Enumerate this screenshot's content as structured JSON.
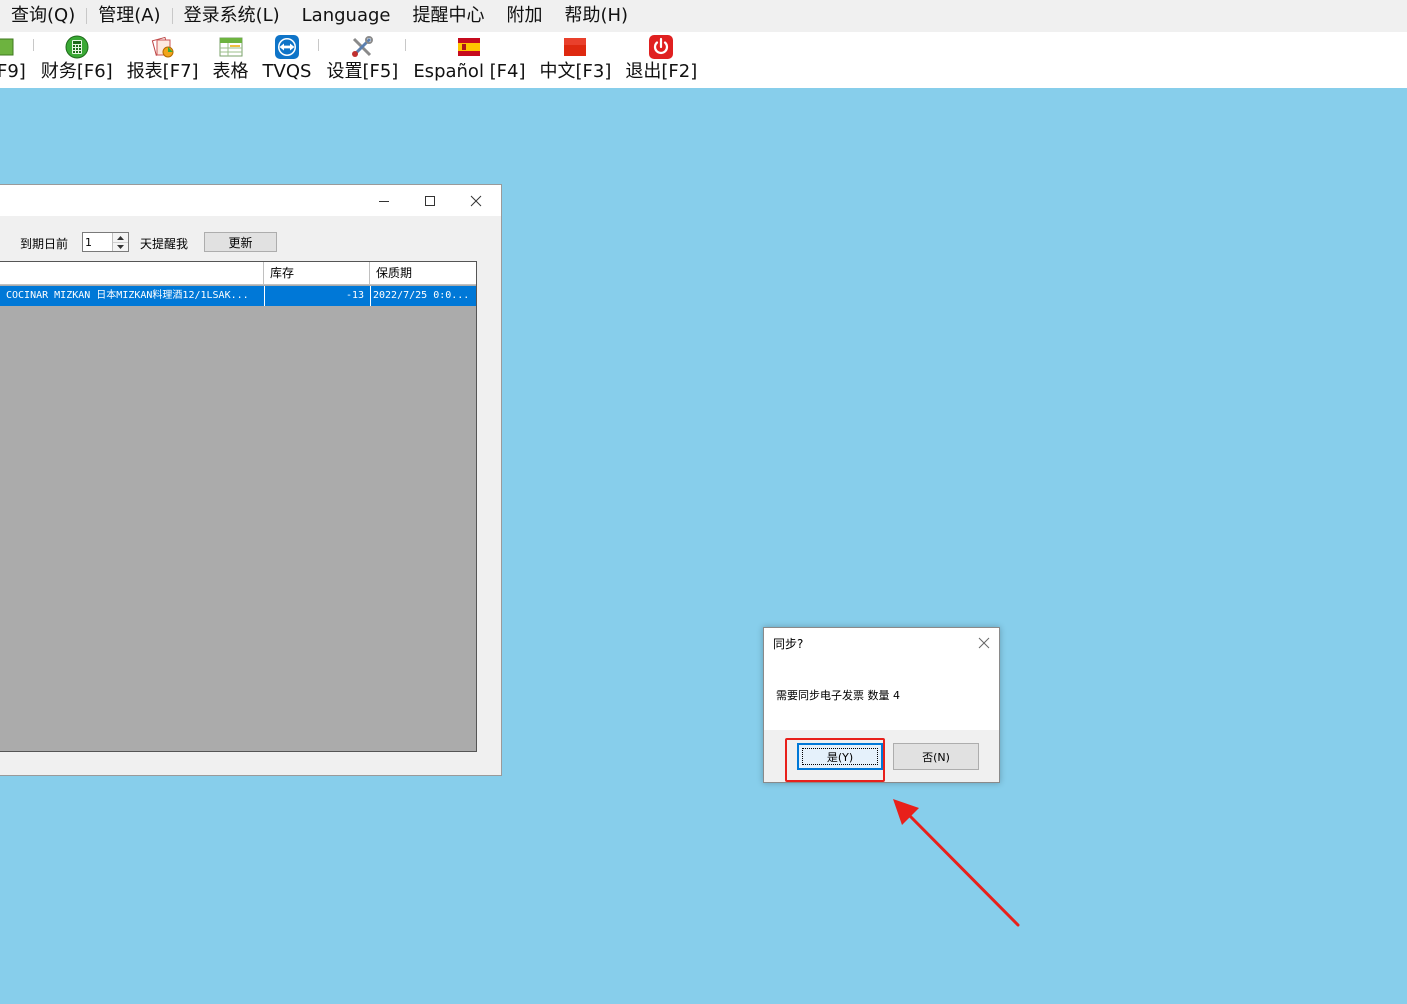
{
  "menubar": {
    "items": [
      "查询(Q)",
      "管理(A)",
      "登录系统(L)",
      "Language",
      "提醒中心",
      "附加",
      "帮助(H)"
    ]
  },
  "toolbar": {
    "items": [
      {
        "label": "F9]",
        "icon": "partial-icon"
      },
      {
        "label": "财务[F6]",
        "icon": "calculator-icon"
      },
      {
        "label": "报表[F7]",
        "icon": "report-icon"
      },
      {
        "label": "表格",
        "icon": "spreadsheet-icon"
      },
      {
        "label": "TVQS",
        "icon": "teamviewer-icon"
      },
      {
        "label": "设置[F5]",
        "icon": "tools-icon"
      },
      {
        "label": "Español [F4]",
        "icon": "spain-flag-icon"
      },
      {
        "label": "中文[F3]",
        "icon": "china-flag-icon"
      },
      {
        "label": "退出[F2]",
        "icon": "power-icon"
      }
    ]
  },
  "reminder_window": {
    "before_label": "到期日前",
    "days_value": "1",
    "after_label": "天提醒我",
    "update_button": "更新",
    "columns": [
      "",
      "库存",
      "保质期"
    ],
    "rows": [
      {
        "name": "COCINAR MIZKAN 日本MIZKAN料理酒12/1LSAK...",
        "stock": "-13",
        "expiry": "2022/7/25 0:0..."
      }
    ]
  },
  "dialog": {
    "title": "同步?",
    "message": "需要同步电子发票 数量 4",
    "yes_label": "是(Y)",
    "no_label": "否(N)"
  },
  "colors": {
    "desktop": "#87ceeb",
    "selection": "#0078d7",
    "annotation": "#e8201b"
  }
}
